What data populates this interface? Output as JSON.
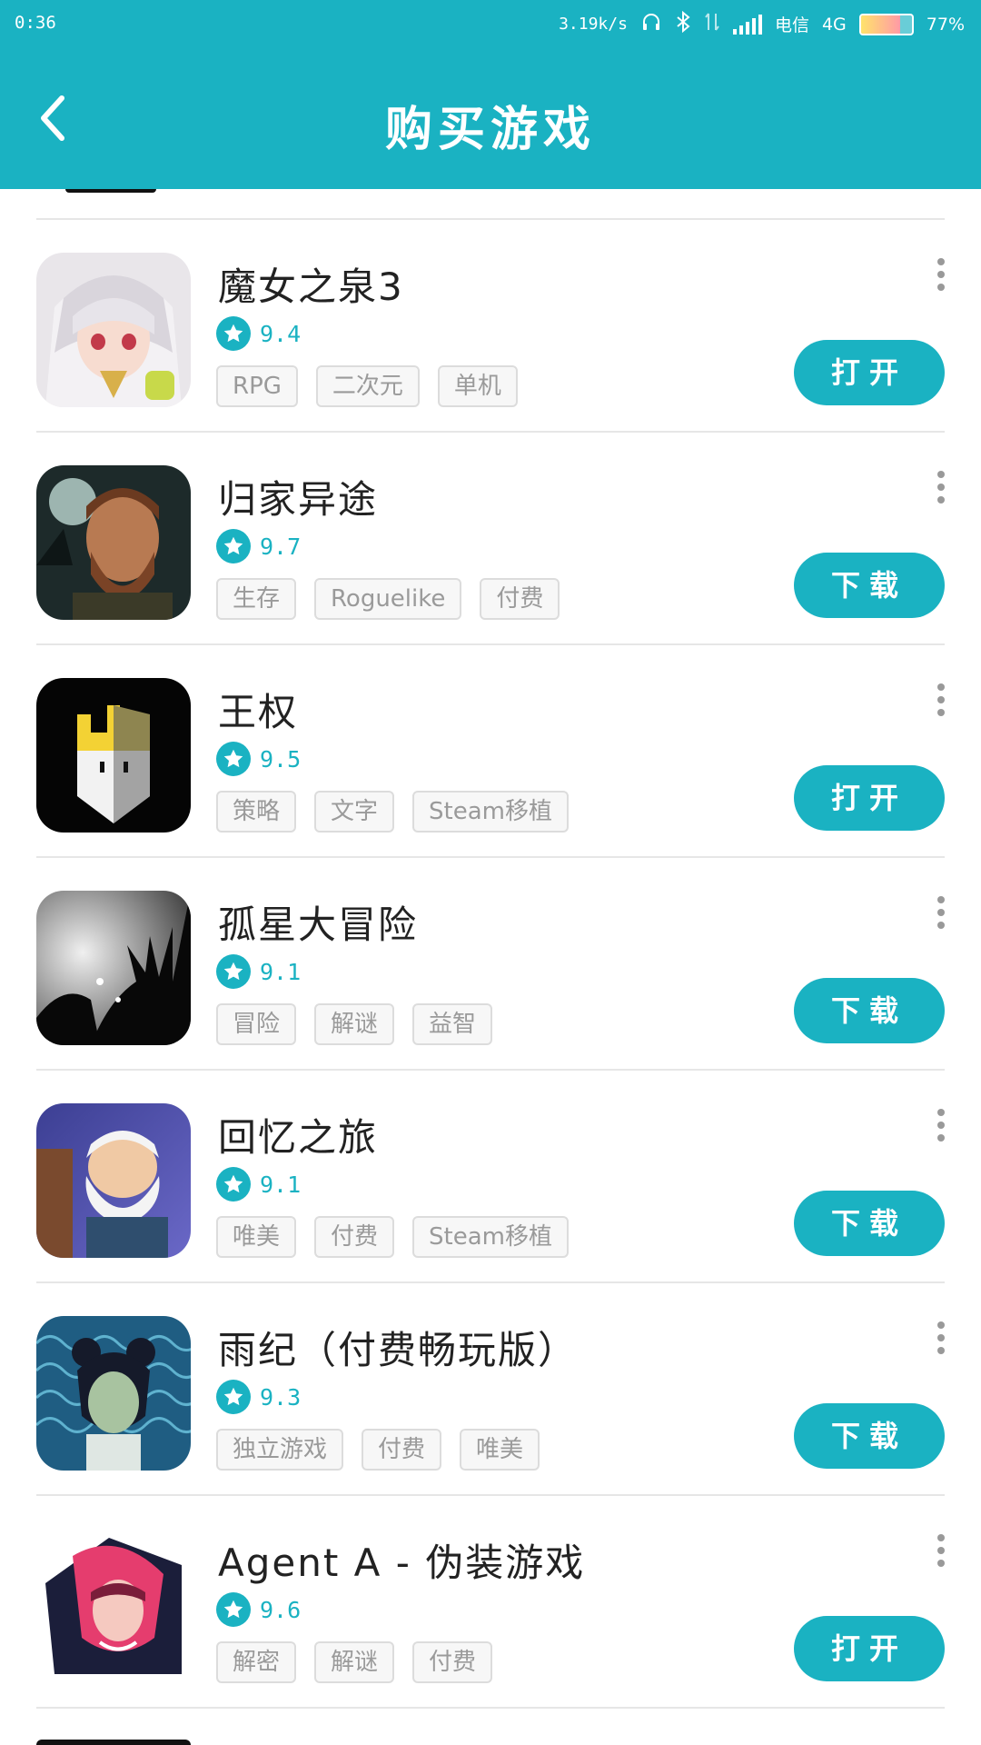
{
  "status_bar": {
    "time": "0:36",
    "speed": "3.19k/s",
    "carrier": "电信",
    "network": "4G",
    "battery": "77%",
    "battery_level": 0.77
  },
  "header": {
    "title": "购买游戏",
    "back_icon": "chevron-left-icon"
  },
  "colors": {
    "accent": "#1ab2c2",
    "tag_border": "#dcdcdc",
    "tag_text": "#9a9a9a"
  },
  "games": [
    {
      "name": "魔女之泉3",
      "rating": "9.4",
      "tags": [
        "RPG",
        "二次元",
        "单机"
      ],
      "action": "打开",
      "icon": "anime-girl-icon"
    },
    {
      "name": "归家异途",
      "rating": "9.7",
      "tags": [
        "生存",
        "Roguelike",
        "付费"
      ],
      "action": "下载",
      "icon": "bearded-man-icon"
    },
    {
      "name": "王权",
      "rating": "9.5",
      "tags": [
        "策略",
        "文字",
        "Steam移植"
      ],
      "action": "打开",
      "icon": "crown-shield-icon"
    },
    {
      "name": "孤星大冒险",
      "rating": "9.1",
      "tags": [
        "冒险",
        "解谜",
        "益智"
      ],
      "action": "下载",
      "icon": "silhouette-icon"
    },
    {
      "name": "回忆之旅",
      "rating": "9.1",
      "tags": [
        "唯美",
        "付费",
        "Steam移植"
      ],
      "action": "下载",
      "icon": "old-man-icon"
    },
    {
      "name": "雨纪（付费畅玩版）",
      "rating": "9.3",
      "tags": [
        "独立游戏",
        "付费",
        "唯美"
      ],
      "action": "下载",
      "icon": "girl-wave-icon"
    },
    {
      "name": "Agent A - 伪装游戏",
      "rating": "9.6",
      "tags": [
        "解密",
        "解谜",
        "付费"
      ],
      "action": "打开",
      "icon": "agent-icon"
    }
  ]
}
